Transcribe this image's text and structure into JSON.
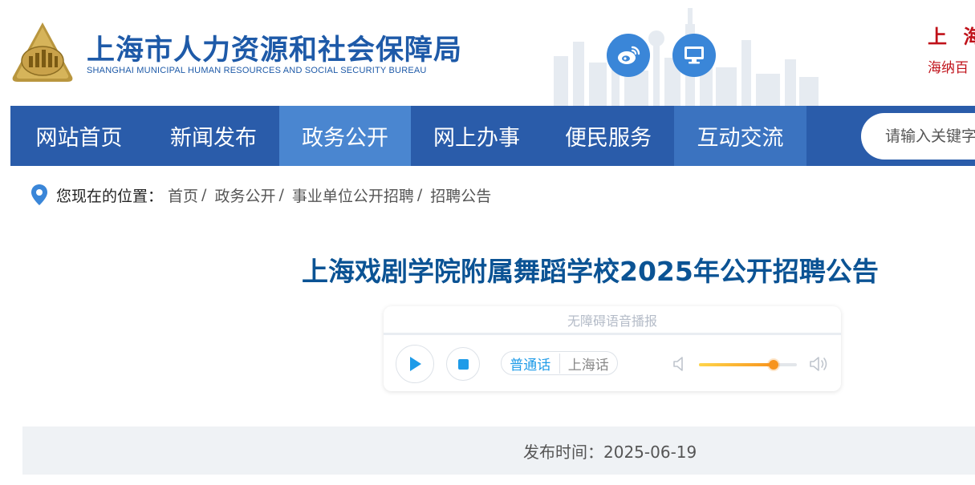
{
  "header": {
    "title": "上海市人力资源和社会保障局",
    "subtitle": "SHANGHAI MUNICIPAL HUMAN RESOURCES AND SOCIAL SECURITY BUREAU",
    "slogan_line1": "上 海",
    "slogan_line2": "海纳百",
    "icons": [
      "weibo-icon",
      "desktop-icon"
    ]
  },
  "nav": {
    "items": [
      {
        "label": "网站首页"
      },
      {
        "label": "新闻发布"
      },
      {
        "label": "政务公开"
      },
      {
        "label": "网上办事"
      },
      {
        "label": "便民服务"
      },
      {
        "label": "互动交流"
      }
    ],
    "active_index": 2,
    "search_placeholder": "请输入关键字"
  },
  "breadcrumb": {
    "label": "您现在的位置：",
    "items": [
      "首页",
      "政务公开",
      "事业单位公开招聘",
      "招聘公告"
    ],
    "separator": "/"
  },
  "article": {
    "title": "上海戏剧学院附属舞蹈学校2025年公开招聘公告",
    "publish_label": "发布时间：",
    "publish_date": "2025-06-19"
  },
  "player": {
    "header": "无障碍语音播报",
    "lang_options": [
      "普通话",
      "上海话"
    ],
    "selected_lang": "普通话",
    "volume": 0.76
  },
  "colors": {
    "nav_bg": "#2a5caa",
    "nav_active": "#4a86d0",
    "title_blue": "#0b5394",
    "slogan_red": "#c0121a",
    "accent_cyan": "#1e9be8"
  }
}
